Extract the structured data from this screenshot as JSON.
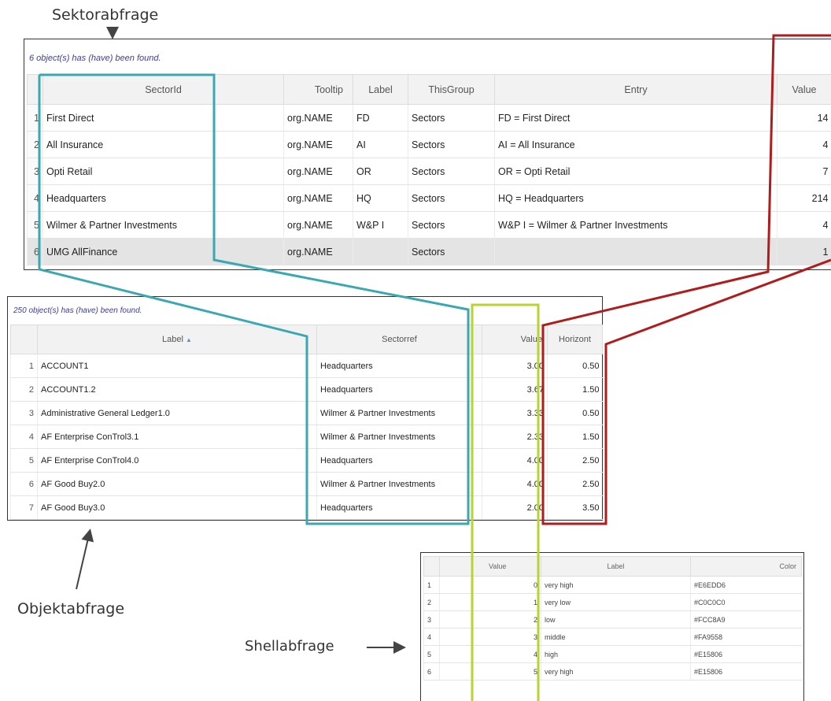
{
  "labels": {
    "sektor": "Sektorabfrage",
    "objekt": "Objektabfrage",
    "shell": "Shellabfrage"
  },
  "sector": {
    "found": "6 object(s) has (have) been found.",
    "columns": [
      "",
      "SectorId",
      "Tooltip",
      "Label",
      "ThisGroup",
      "Entry",
      "Value"
    ],
    "rows": [
      {
        "n": "1",
        "id": "First Direct",
        "tooltip": "org.NAME",
        "label": "FD",
        "group": "Sectors",
        "entry": "FD = First Direct",
        "value": "14"
      },
      {
        "n": "2",
        "id": "All Insurance",
        "tooltip": "org.NAME",
        "label": "AI",
        "group": "Sectors",
        "entry": "AI = All Insurance",
        "value": "4"
      },
      {
        "n": "3",
        "id": "Opti Retail",
        "tooltip": "org.NAME",
        "label": "OR",
        "group": "Sectors",
        "entry": "OR = Opti Retail",
        "value": "7"
      },
      {
        "n": "4",
        "id": "Headquarters",
        "tooltip": "org.NAME",
        "label": "HQ",
        "group": "Sectors",
        "entry": "HQ = Headquarters",
        "value": "214"
      },
      {
        "n": "5",
        "id": "Wilmer & Partner Investments",
        "tooltip": "org.NAME",
        "label": "W&P I",
        "group": "Sectors",
        "entry": "W&P I = Wilmer & Partner Investments",
        "value": "4"
      },
      {
        "n": "6",
        "id": "UMG AllFinance",
        "tooltip": "org.NAME",
        "label": "",
        "group": "Sectors",
        "entry": "",
        "value": "1"
      }
    ]
  },
  "object": {
    "found": "250 object(s) has (have) been found.",
    "columns": [
      "",
      "Label",
      "Sectorref",
      "Value",
      "Horizont"
    ],
    "sort_indicator": "▲",
    "rows": [
      {
        "n": "1",
        "label": "ACCOUNT1",
        "sector": "Headquarters",
        "value": "3.00",
        "horizont": "0.50"
      },
      {
        "n": "2",
        "label": "ACCOUNT1.2",
        "sector": "Headquarters",
        "value": "3.67",
        "horizont": "1.50"
      },
      {
        "n": "3",
        "label": "Administrative General Ledger1.0",
        "sector": "Wilmer & Partner Investments",
        "value": "3.33",
        "horizont": "0.50"
      },
      {
        "n": "4",
        "label": "AF Enterprise ConTrol3.1",
        "sector": "Wilmer & Partner Investments",
        "value": "2.33",
        "horizont": "1.50"
      },
      {
        "n": "5",
        "label": "AF Enterprise ConTrol4.0",
        "sector": "Headquarters",
        "value": "4.00",
        "horizont": "2.50"
      },
      {
        "n": "6",
        "label": "AF Good Buy2.0",
        "sector": "Wilmer & Partner Investments",
        "value": "4.00",
        "horizont": "2.50"
      },
      {
        "n": "7",
        "label": "AF Good Buy3.0",
        "sector": "Headquarters",
        "value": "2.00",
        "horizont": "3.50"
      }
    ]
  },
  "shell": {
    "columns": [
      "",
      "Value",
      "Label",
      "Color"
    ],
    "rows": [
      {
        "n": "1",
        "value": "0",
        "label": "very high",
        "color": "#E6EDD6"
      },
      {
        "n": "2",
        "value": "1",
        "label": "very low",
        "color": "#C0C0C0"
      },
      {
        "n": "3",
        "value": "2",
        "label": "low",
        "color": "#FCC8A9"
      },
      {
        "n": "4",
        "value": "3",
        "label": "middle",
        "color": "#FA9558"
      },
      {
        "n": "5",
        "value": "4",
        "label": "high",
        "color": "#E15806"
      },
      {
        "n": "6",
        "value": "5",
        "label": "very high",
        "color": "#E15806"
      }
    ]
  },
  "highlight_colors": {
    "sectorid_link": "#3aa8b0",
    "value_link": "#b01c1c",
    "shell_link": "#b8d432",
    "arrow": "#444444"
  }
}
